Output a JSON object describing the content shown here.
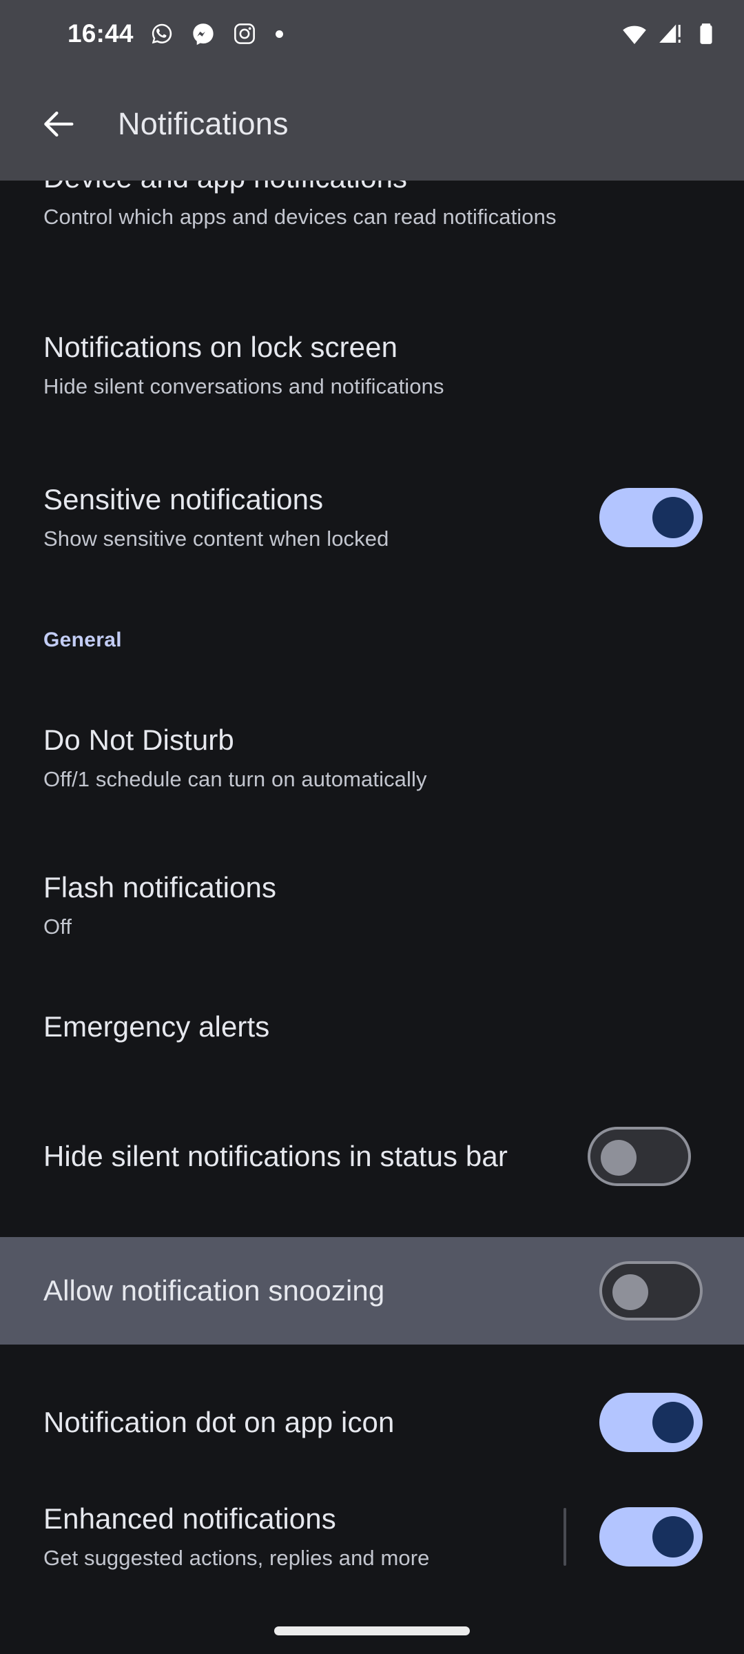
{
  "status_bar": {
    "clock": "16:44",
    "left_icons": [
      {
        "name": "whatsapp-icon",
        "label": "WhatsApp"
      },
      {
        "name": "messenger-icon",
        "label": "Messenger"
      },
      {
        "name": "instagram-icon",
        "label": "Instagram"
      },
      {
        "name": "more-notifications-dot",
        "label": "More notifications"
      }
    ],
    "right_icons": [
      {
        "name": "wifi-icon",
        "label": "Wi-Fi"
      },
      {
        "name": "cellular-signal-warning-icon",
        "label": "No service"
      },
      {
        "name": "battery-icon",
        "label": "Battery"
      }
    ]
  },
  "app_bar": {
    "back_label": "Back",
    "title": "Notifications"
  },
  "sections": [
    {
      "header": null,
      "rows": [
        {
          "name": "device-and-app-notifications",
          "title": "Device and app notifications",
          "subtitle": "Control which apps and devices can read notifications",
          "control": "none",
          "clipped": true
        },
        {
          "name": "notifications-on-lock-screen",
          "title": "Notifications on lock screen",
          "subtitle": "Hide silent conversations and notifications",
          "control": "none"
        },
        {
          "name": "sensitive-notifications",
          "title": "Sensitive notifications",
          "subtitle": "Show sensitive content when locked",
          "control": "toggle",
          "toggle_state": "on"
        }
      ]
    },
    {
      "header": "General",
      "rows": [
        {
          "name": "do-not-disturb",
          "title": "Do Not Disturb",
          "subtitle": "Off/1 schedule can turn on automatically",
          "control": "none"
        },
        {
          "name": "flash-notifications",
          "title": "Flash notifications",
          "subtitle": "Off",
          "control": "none"
        },
        {
          "name": "emergency-alerts",
          "title": "Emergency alerts",
          "subtitle": null,
          "control": "none"
        },
        {
          "name": "hide-silent-notifications-in-status-bar",
          "title": "Hide silent notifications in status bar",
          "subtitle": null,
          "control": "toggle",
          "toggle_state": "off"
        },
        {
          "name": "allow-notification-snoozing",
          "title": "Allow notification snoozing",
          "subtitle": null,
          "control": "toggle",
          "toggle_state": "off",
          "highlighted": true
        },
        {
          "name": "notification-dot-on-app-icon",
          "title": "Notification dot on app icon",
          "subtitle": null,
          "control": "toggle",
          "toggle_state": "on"
        },
        {
          "name": "enhanced-notifications",
          "title": "Enhanced notifications",
          "subtitle": "Get suggested actions, replies and more",
          "control": "toggle",
          "toggle_state": "on",
          "divider": true
        }
      ]
    }
  ],
  "colors": {
    "app_bar_bg": "#45464c",
    "page_bg": "#141518",
    "title_text": "#e6e8ee",
    "subtitle_text": "#c3c6cf",
    "section_header": "#c3cdf5",
    "toggle_on_track": "#b3c5ff",
    "toggle_on_thumb": "#17305e",
    "toggle_off_track": "#303136",
    "toggle_off_outline": "#8e9099",
    "row_highlight": "#545764",
    "divider": "#494b52",
    "home_indicator": "#ececec"
  }
}
